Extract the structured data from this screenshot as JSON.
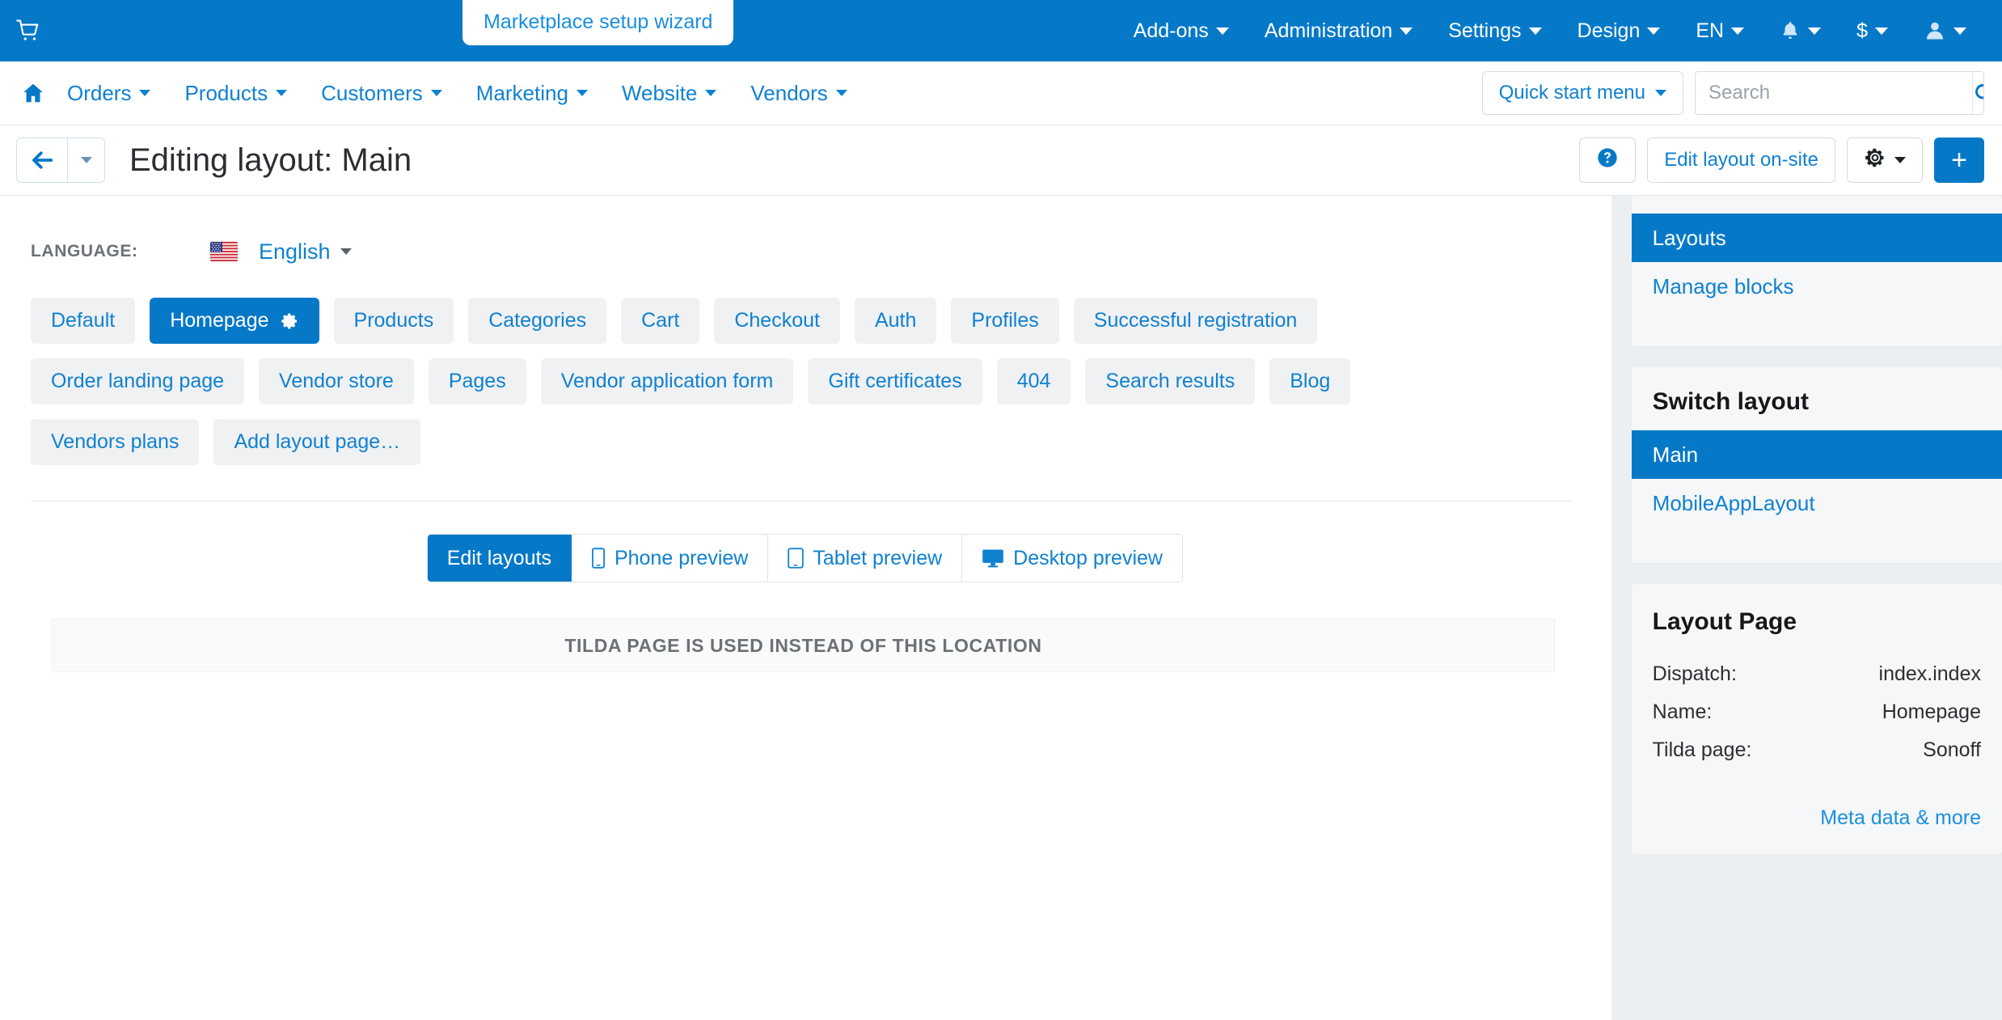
{
  "topbar": {
    "cart_icon": "cart-icon",
    "wizard_tab": "Marketplace setup wizard",
    "menus": [
      {
        "label": "Add-ons"
      },
      {
        "label": "Administration"
      },
      {
        "label": "Settings"
      },
      {
        "label": "Design"
      },
      {
        "label": "EN"
      }
    ],
    "bell_icon": "bell-icon",
    "currency_label": "$",
    "user_icon": "user-icon"
  },
  "mainnav": {
    "home_icon": "home-icon",
    "items": [
      {
        "label": "Orders"
      },
      {
        "label": "Products"
      },
      {
        "label": "Customers"
      },
      {
        "label": "Marketing"
      },
      {
        "label": "Website"
      },
      {
        "label": "Vendors"
      }
    ],
    "quick_start_label": "Quick start menu",
    "search": {
      "value": "",
      "placeholder": "Search",
      "icon": "search-icon"
    }
  },
  "titlebar": {
    "back_icon": "arrow-left-icon",
    "title": "Editing layout: Main",
    "help_icon": "help-circle-icon",
    "edit_onsite_label": "Edit layout on-site",
    "gear_icon": "gear-icon",
    "plus_label": "+"
  },
  "content": {
    "language_label": "LANGUAGE:",
    "language_value": "English",
    "flag_icon": "us-flag-icon",
    "layout_tabs": [
      {
        "label": "Default",
        "active": false,
        "gear": false
      },
      {
        "label": "Homepage",
        "active": true,
        "gear": true
      },
      {
        "label": "Products",
        "active": false,
        "gear": false
      },
      {
        "label": "Categories",
        "active": false,
        "gear": false
      },
      {
        "label": "Cart",
        "active": false,
        "gear": false
      },
      {
        "label": "Checkout",
        "active": false,
        "gear": false
      },
      {
        "label": "Auth",
        "active": false,
        "gear": false
      },
      {
        "label": "Profiles",
        "active": false,
        "gear": false
      },
      {
        "label": "Successful registration",
        "active": false,
        "gear": false
      },
      {
        "label": "Order landing page",
        "active": false,
        "gear": false
      },
      {
        "label": "Vendor store",
        "active": false,
        "gear": false
      },
      {
        "label": "Pages",
        "active": false,
        "gear": false
      },
      {
        "label": "Vendor application form",
        "active": false,
        "gear": false
      },
      {
        "label": "Gift certificates",
        "active": false,
        "gear": false
      },
      {
        "label": "404",
        "active": false,
        "gear": false
      },
      {
        "label": "Search results",
        "active": false,
        "gear": false
      },
      {
        "label": "Blog",
        "active": false,
        "gear": false
      },
      {
        "label": "Vendors plans",
        "active": false,
        "gear": false
      },
      {
        "label": "Add layout page…",
        "active": false,
        "gear": false
      }
    ],
    "preview_tabs": [
      {
        "label": "Edit layouts",
        "icon": "",
        "active": true
      },
      {
        "label": "Phone preview",
        "icon": "phone-icon",
        "active": false
      },
      {
        "label": "Tablet preview",
        "icon": "tablet-icon",
        "active": false
      },
      {
        "label": "Desktop preview",
        "icon": "desktop-icon",
        "active": false
      }
    ],
    "tilda_note": "TILDA PAGE IS USED INSTEAD OF THIS LOCATION"
  },
  "sidebar": {
    "nav": [
      {
        "label": "Layouts",
        "active": true
      },
      {
        "label": "Manage blocks",
        "active": false
      }
    ],
    "switch_layout_heading": "Switch layout",
    "layouts": [
      {
        "label": "Main",
        "active": true
      },
      {
        "label": "MobileAppLayout",
        "active": false
      }
    ],
    "layout_page": {
      "heading": "Layout Page",
      "rows": [
        {
          "label": "Dispatch:",
          "value": "index.index"
        },
        {
          "label": "Name:",
          "value": "Homepage"
        },
        {
          "label": "Tilda page:",
          "value": "Sonoff"
        }
      ],
      "meta_link": "Meta data & more"
    }
  },
  "colors": {
    "brand_blue": "#0579c8",
    "link_blue": "#0f81d1",
    "page_bg": "#eceff1",
    "panel_bg": "#f6f7f8",
    "tab_bg": "#f0f1f2"
  }
}
